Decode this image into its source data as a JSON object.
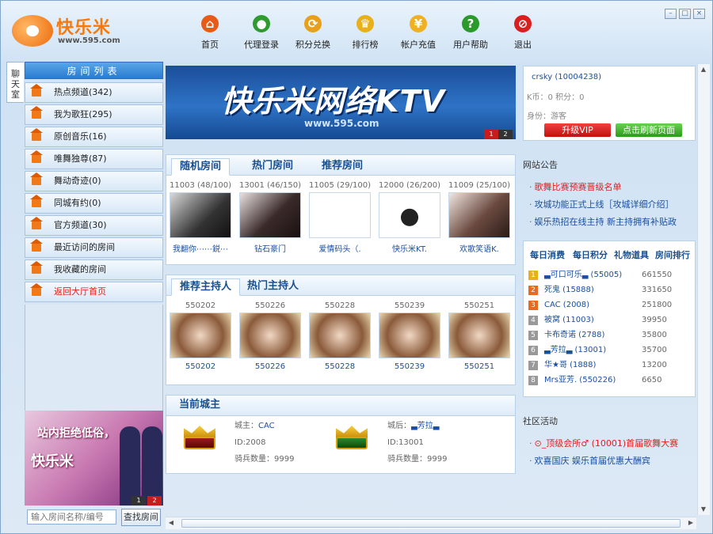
{
  "app": {
    "logo_text": "快乐米",
    "logo_url": "www.595.com"
  },
  "colors": {
    "accent": "#2a7bd0",
    "orange": "#f47a10",
    "red": "#e02020",
    "link": "#1a4fa0"
  },
  "nav": [
    {
      "label": "首页",
      "icon": "home-icon",
      "color": "#e85a1a"
    },
    {
      "label": "代理登录",
      "icon": "user-login-icon",
      "color": "#2f9a2f"
    },
    {
      "label": "积分兑换",
      "icon": "exchange-icon",
      "color": "#e8a01a"
    },
    {
      "label": "排行榜",
      "icon": "crown-icon",
      "color": "#e8b01a"
    },
    {
      "label": "帐户充值",
      "icon": "coin-icon",
      "color": "#f0b020"
    },
    {
      "label": "用户帮助",
      "icon": "help-icon",
      "color": "#2a9a2a"
    },
    {
      "label": "退出",
      "icon": "exit-icon",
      "color": "#d82020"
    }
  ],
  "sidebar": {
    "vertical_tab": "聊天室",
    "header": "房间列表",
    "items": [
      {
        "label": "热点频道(342)"
      },
      {
        "label": "我为歌狂(295)"
      },
      {
        "label": "原创音乐(16)"
      },
      {
        "label": "唯舞独尊(87)"
      },
      {
        "label": "舞动奇迹(0)"
      },
      {
        "label": "同城有约(0)"
      },
      {
        "label": "官方频道(30)"
      },
      {
        "label": "最近访问的房间"
      },
      {
        "label": "我收藏的房间"
      },
      {
        "label": "返回大厅首页"
      }
    ],
    "ad": {
      "line1": "站内拒绝低俗，",
      "line2": "快乐米",
      "pages": [
        "1",
        "2"
      ]
    },
    "search": {
      "placeholder": "输入房间名称/编号",
      "button": "查找房间"
    }
  },
  "banner": {
    "title": "快乐米网络KTV",
    "url": "www.595.com",
    "pages": [
      "1",
      "2"
    ]
  },
  "rooms": {
    "tabs": [
      "随机房间",
      "热门房间",
      "推荐房间"
    ],
    "items": [
      {
        "caption": "11003 (48/100)",
        "name": "我翻你⋯⋯鋭⋯"
      },
      {
        "caption": "13001 (46/150)",
        "name": "钻石豪门"
      },
      {
        "caption": "11005 (29/100)",
        "name": "爱情码头（."
      },
      {
        "caption": "12000 (26/200)",
        "name": "快乐米KT."
      },
      {
        "caption": "11009 (25/100)",
        "name": "欢歌笑语K."
      }
    ]
  },
  "hosts": {
    "tabs": [
      "推荐主持人",
      "热门主持人"
    ],
    "items": [
      {
        "caption": "550202",
        "name": "550202"
      },
      {
        "caption": "550226",
        "name": "550226"
      },
      {
        "caption": "550228",
        "name": "550228"
      },
      {
        "caption": "550239",
        "name": "550239"
      },
      {
        "caption": "550251",
        "name": "550251"
      }
    ]
  },
  "lords": {
    "title": "当前城主",
    "lord": {
      "name_label": "城主：",
      "name": "CAC",
      "id_label": "ID:",
      "id": "2008",
      "troops_label": "骑兵数量：",
      "troops": "9999"
    },
    "lady": {
      "name_label": "城后：",
      "name": "▃芳拉▃",
      "id_label": "ID:",
      "id": "13001",
      "troops_label": "骑兵数量：",
      "troops": "9999"
    }
  },
  "user": {
    "name": "crsky (10004238)",
    "points": "K币：0 积分：0",
    "identity": "身份：游客",
    "upgrade_button": "升级VIP",
    "refresh_button": "点击刷新页面"
  },
  "announce": {
    "title": "网站公告",
    "items": [
      {
        "text": "歌舞比赛预赛晋级名单",
        "color": "#e02020"
      },
      {
        "text": "攻城功能正式上线［攻城详细介绍］",
        "color": "#1a4fa0"
      },
      {
        "text": "娱乐热招在线主持 新主持拥有补贴政",
        "color": "#1a4fa0"
      }
    ]
  },
  "rank": {
    "tabs": [
      "每日消费",
      "每日积分",
      "礼物道具",
      "房间排行"
    ],
    "rows": [
      {
        "num": "1",
        "name": "▃可口可乐▃ (55005)",
        "value": "661550"
      },
      {
        "num": "2",
        "name": "死鬼 (15888)",
        "value": "331650"
      },
      {
        "num": "3",
        "name": "CAC (2008)",
        "value": "251800"
      },
      {
        "num": "4",
        "name": "被窝 (11003)",
        "value": "39950"
      },
      {
        "num": "5",
        "name": "卡布奇诺 (2788)",
        "value": "35800"
      },
      {
        "num": "6",
        "name": "▃芳拉▃ (13001)",
        "value": "35700"
      },
      {
        "num": "7",
        "name": "华★哥 (1888)",
        "value": "13200"
      },
      {
        "num": "8",
        "name": "Mrs亚芳. (550226)",
        "value": "6650"
      }
    ]
  },
  "community": {
    "title": "社区活动",
    "items": [
      {
        "text": "⊙_顶级会所♂ (10001)首届歌舞大赛",
        "color": "#e02020"
      },
      {
        "text": "欢喜国庆 娱乐首届优惠大酬宾",
        "color": "#1a4fa0"
      }
    ]
  },
  "window_controls": [
    "minimize",
    "maximize",
    "close"
  ]
}
